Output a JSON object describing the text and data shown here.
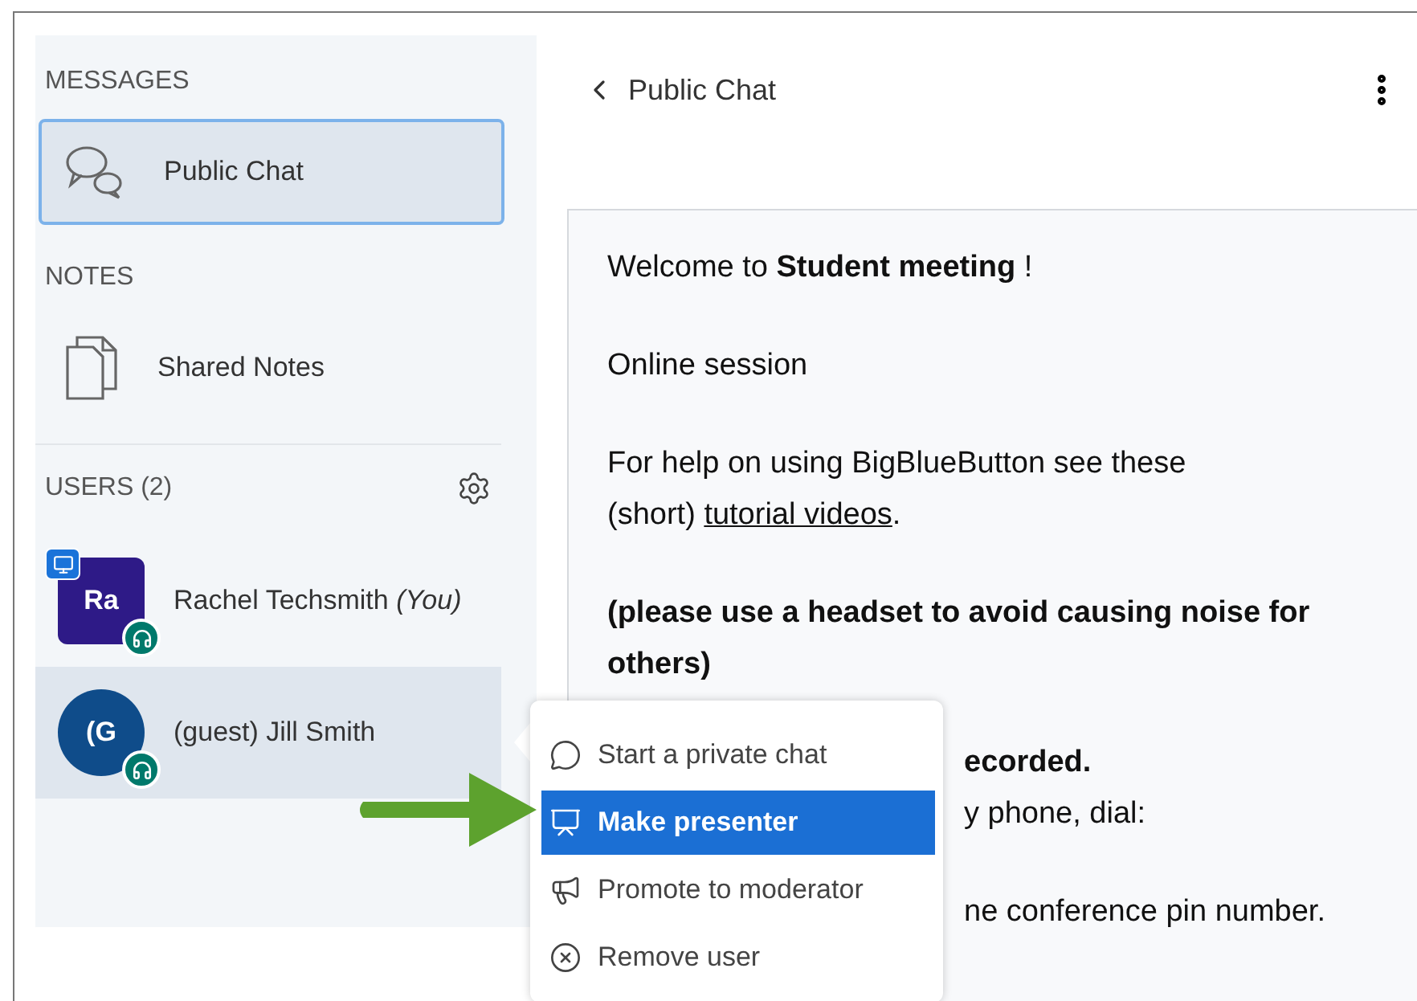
{
  "sidebar": {
    "sections": [
      {
        "title": "MESSAGES",
        "items": [
          {
            "label": "Public Chat",
            "kind": "chat",
            "selected": true
          }
        ]
      },
      {
        "title": "NOTES",
        "items": [
          {
            "label": "Shared Notes",
            "kind": "notes",
            "selected": false
          }
        ]
      }
    ],
    "users": {
      "title": "USERS (2)",
      "list": [
        {
          "initials": "Ra",
          "name": "Rachel Techsmith",
          "suffix": "(You)",
          "kind": "moderator",
          "color": "#2e1a87",
          "presenter": true,
          "selected": false
        },
        {
          "initials": "(G",
          "name": "(guest) Jill Smith",
          "kind": "viewer",
          "color": "#0f4c8a",
          "presenter": false,
          "selected": true
        }
      ]
    }
  },
  "chat": {
    "title": "Public Chat",
    "paragraphs": [
      [
        {
          "text": "Welcome to **Student meeting** !"
        }
      ],
      [
        {
          "text": "Online session"
        }
      ],
      [
        {
          "text": "For help on using BigBlueButton see these"
        },
        {
          "text": "(short) ",
          "link": "tutorial videos",
          "after": "."
        }
      ],
      [
        {
          "text": "(please use a headset to avoid causing noise for",
          "bold": true
        },
        {
          "text": "others)",
          "bold": true
        }
      ],
      [
        {
          "text": "ecorded.",
          "bold": true,
          "partial": true
        },
        {
          "text": "y phone, dial:",
          "partial": true
        }
      ],
      [
        {
          "text": "ne conference pin number.",
          "partial": true
        }
      ]
    ]
  },
  "menu": {
    "items": [
      {
        "label": "Start a private chat",
        "kind": "chat",
        "selected": false
      },
      {
        "label": "Make presenter",
        "kind": "presenter",
        "selected": true
      },
      {
        "label": "Promote to moderator",
        "kind": "promote",
        "selected": false
      },
      {
        "label": "Remove user",
        "kind": "remove",
        "selected": false
      }
    ]
  }
}
